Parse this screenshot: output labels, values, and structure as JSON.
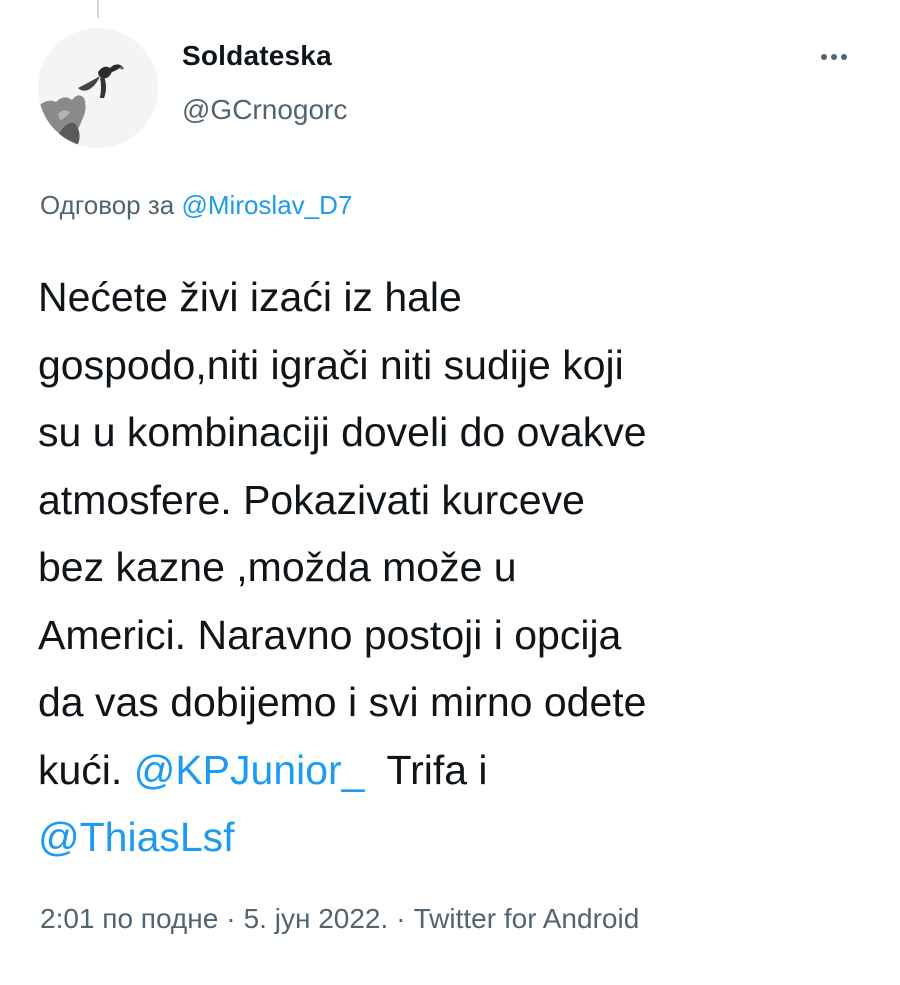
{
  "tweet": {
    "display_name": "Soldateska",
    "handle": "@GCrnogorc",
    "more_icon": "more-horizontal-icon",
    "reply_prefix": "Одговор за",
    "reply_to": "@Miroslav_D7",
    "body": {
      "line1": "Nećete živi izaći iz hale",
      "line2": "gospodo,niti igrači niti sudije koji",
      "line3": "su u kombinaciji doveli do ovakve",
      "line4": "atmosfere. Pokazivati kurceve",
      "line5": "bez kazne ,možda može u",
      "line6": "Americi. Naravno postoji i opcija",
      "line7": "da vas dobijemo i svi mirno odete",
      "line8_text": "kući. ",
      "mention1": "@KPJunior_",
      "line8_tail": "  Trifa i",
      "mention2": "@ThiasLsf"
    },
    "time": "2:01 по подне",
    "date": "5. јун 2022.",
    "separator": "·",
    "source": "Twitter for Android"
  },
  "colors": {
    "text": "#0f1419",
    "secondary": "#536471",
    "accent": "#1d9bf0",
    "thread_line": "#cfd9de"
  }
}
